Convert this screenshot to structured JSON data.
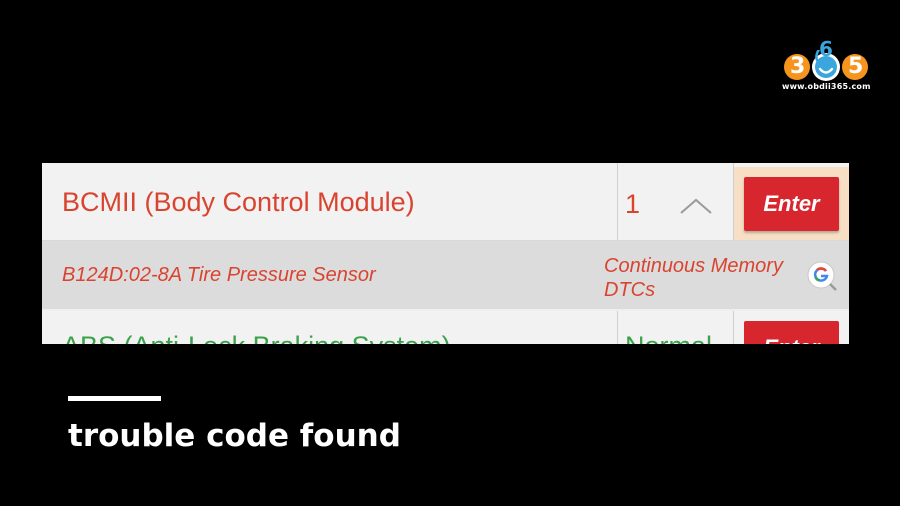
{
  "logo": {
    "digits": [
      "3",
      "6",
      "5"
    ],
    "url": "www.obdii365.com",
    "colors": {
      "orange": "#f7941d",
      "blue": "#3aa6dd",
      "white": "#ffffff"
    }
  },
  "module_row": {
    "name": "BCMII (Body Control Module)",
    "count": "1",
    "chevron_icon": "chevron-up-icon",
    "enter_label": "Enter"
  },
  "dtc_row": {
    "code_text": "B124D:02-8A Tire Pressure Sensor",
    "status_text": "Continuous Memory DTCs",
    "search_icon": "google-search-icon"
  },
  "abs_row": {
    "name": "ABS (Anti-Lock Braking System)",
    "status": "Normal",
    "enter_label": "Enter"
  },
  "caption": {
    "text": "trouble code found"
  },
  "colors": {
    "fault_text": "#d94430",
    "normal_text": "#3aa24a",
    "enter_button": "#d8262f",
    "highlight_cell": "#f6dfc4"
  }
}
